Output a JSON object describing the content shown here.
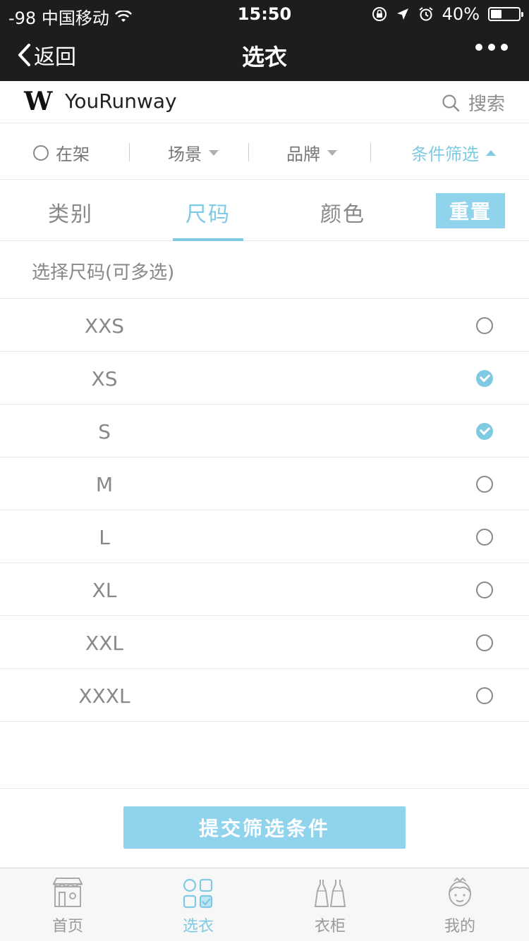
{
  "status_bar": {
    "signal": "-98 中国移动",
    "time": "15:50",
    "battery": "40%",
    "battery_level": 0.4,
    "icons": [
      "wifi-icon",
      "rotation-lock-icon",
      "location-icon",
      "alarm-icon",
      "battery-icon"
    ]
  },
  "nav": {
    "back_label": "返回",
    "title": "选衣",
    "more_icon": "more-dots-icon"
  },
  "brand": {
    "logo_text": "W",
    "name": "YouRunway",
    "search_label": "搜索"
  },
  "filters": {
    "on_shelf": "在架",
    "scene": "场景",
    "brand": "品牌",
    "conditions": "条件筛选"
  },
  "category_tabs": {
    "items": [
      "类别",
      "尺码",
      "颜色"
    ],
    "active": "尺码",
    "reset_label": "重置"
  },
  "size_section": {
    "header": "选择尺码(可多选)",
    "sizes": [
      {
        "label": "XXS",
        "checked": false
      },
      {
        "label": "XS",
        "checked": true
      },
      {
        "label": "S",
        "checked": true
      },
      {
        "label": "M",
        "checked": false
      },
      {
        "label": "L",
        "checked": false
      },
      {
        "label": "XL",
        "checked": false
      },
      {
        "label": "XXL",
        "checked": false
      },
      {
        "label": "XXXL",
        "checked": false
      }
    ]
  },
  "submit_label": "提交筛选条件",
  "tabbar": {
    "items": [
      {
        "label": "首页",
        "icon": "store-icon"
      },
      {
        "label": "选衣",
        "icon": "select-clothes-icon"
      },
      {
        "label": "衣柜",
        "icon": "wardrobe-icon"
      },
      {
        "label": "我的",
        "icon": "profile-icon"
      }
    ],
    "active": "选衣"
  },
  "colors": {
    "accent": "#7ecae3",
    "button": "#8fd3ec",
    "nav_bg": "#1d1d1f"
  }
}
